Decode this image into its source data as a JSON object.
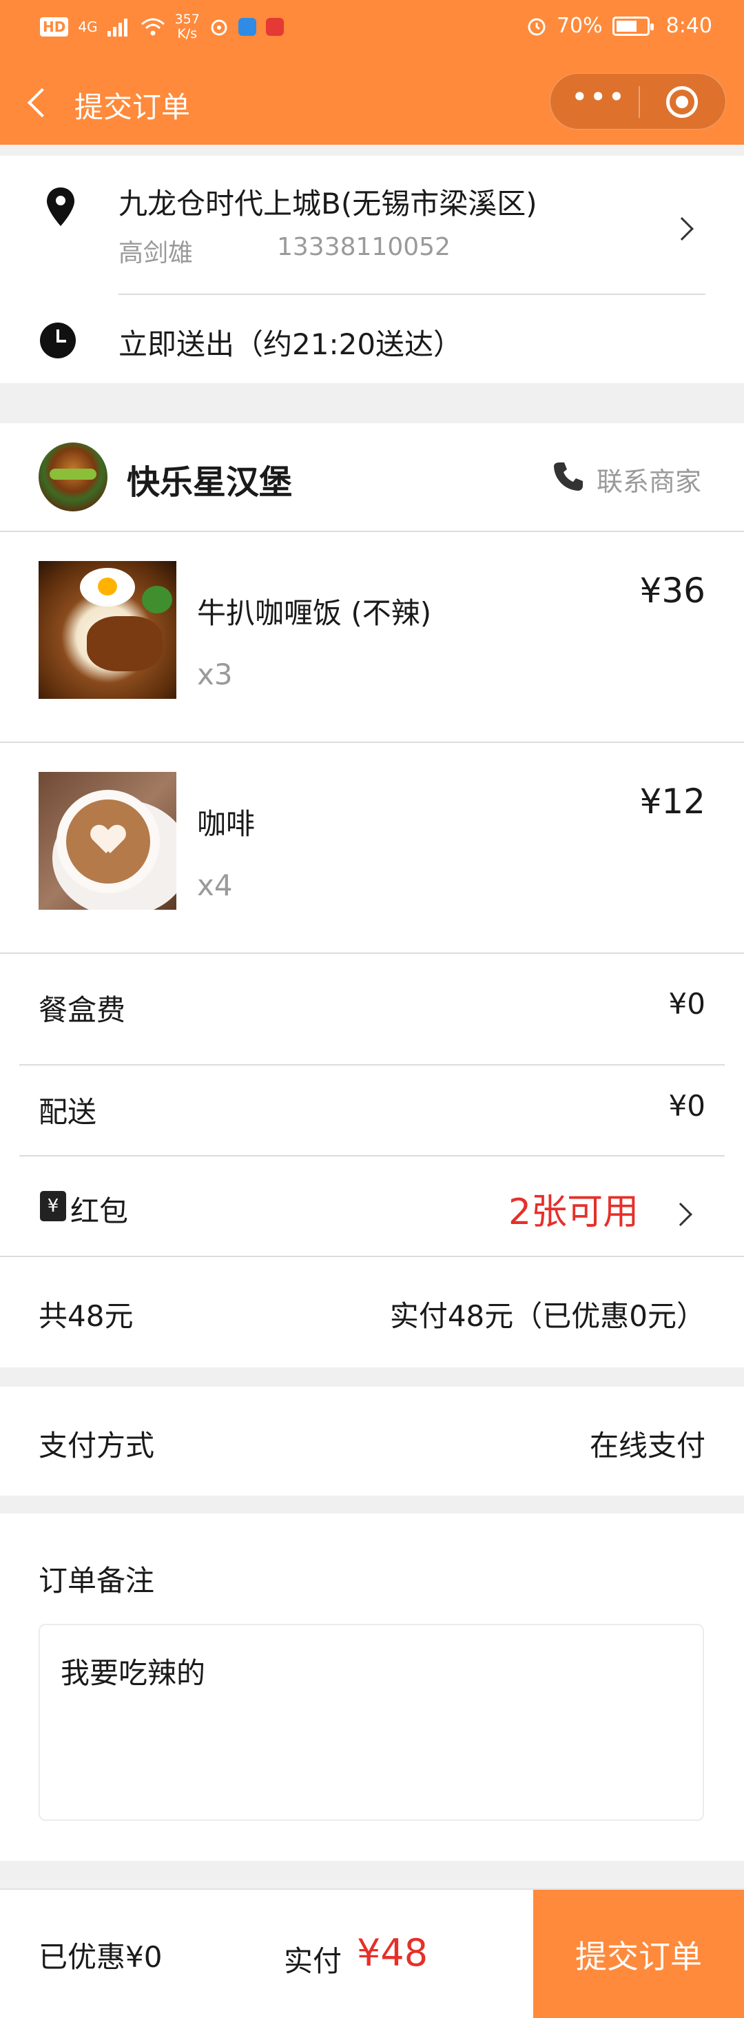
{
  "status_bar": {
    "hd": "HD",
    "network": "4G",
    "speed_top": "357",
    "speed_bottom": "K/s",
    "battery_pct": "70%",
    "battery_fraction": 0.7,
    "time": "8:40"
  },
  "nav": {
    "title": "提交订单",
    "more_label": "•••"
  },
  "address": {
    "place": "九龙仓时代上城B(无锡市梁溪区)",
    "contact_name": "高剑雄",
    "phone": "13338110052",
    "delivery_time": "立即送出（约21:20送达）"
  },
  "shop": {
    "name": "快乐星汉堡",
    "contact_label": "联系商家",
    "items": [
      {
        "name": "牛扒咖喱饭 (不辣)",
        "qty": "x3",
        "price": "¥36"
      },
      {
        "name": "咖啡",
        "qty": "x4",
        "price": "¥12"
      }
    ],
    "box_fee_label": "餐盒费",
    "box_fee_value": "¥0",
    "delivery_label": "配送",
    "delivery_value": "¥0",
    "redpack_icon_text": "¥",
    "redpack_label": "红包",
    "redpack_value": "2张可用",
    "total_label": "共48元",
    "paid_summary": "实付48元（已优惠0元）"
  },
  "payment": {
    "label": "支付方式",
    "value": "在线支付"
  },
  "note": {
    "label": "订单备注",
    "value": "我要吃辣的"
  },
  "bottom_bar": {
    "discount": "已优惠¥0",
    "paid_label": "实付",
    "paid_amount": "¥48",
    "submit_label": "提交订单"
  },
  "colors": {
    "brand": "#ff8a3b",
    "accent_red": "#e5302a"
  },
  "icons": [
    "back-arrow-icon",
    "more-dots-icon",
    "miniapp-close-icon",
    "location-pin-icon",
    "clock-icon",
    "phone-icon",
    "red-packet-icon",
    "chevron-right-icon"
  ]
}
